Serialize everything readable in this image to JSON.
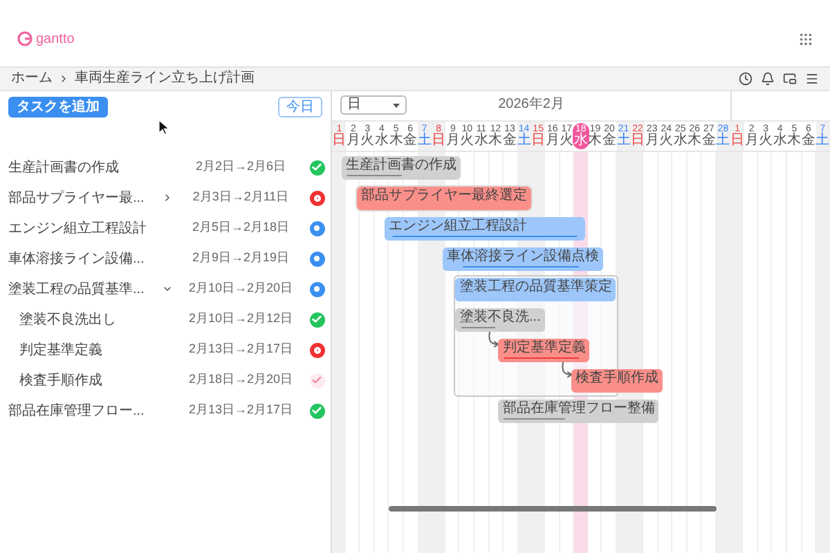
{
  "app": {
    "logo": "gantto"
  },
  "breadcrumb": [
    "ホーム",
    "車両生産ライン立ち上げ計画"
  ],
  "toolbar": {
    "add_button": "タスクを追加",
    "today_button": "今日",
    "scale_select": "日"
  },
  "month": "2026年2月",
  "days": [
    {
      "day": "1",
      "weekday": "日",
      "kind": "sunday",
      "selected": false
    },
    {
      "day": "2",
      "weekday": "月",
      "kind": "weekday",
      "selected": false
    },
    {
      "day": "3",
      "weekday": "火",
      "kind": "weekday",
      "selected": false
    },
    {
      "day": "4",
      "weekday": "水",
      "kind": "weekday",
      "selected": false
    },
    {
      "day": "5",
      "weekday": "木",
      "kind": "weekday",
      "selected": false
    },
    {
      "day": "6",
      "weekday": "金",
      "kind": "weekday",
      "selected": false
    },
    {
      "day": "7",
      "weekday": "土",
      "kind": "saturday",
      "selected": false
    },
    {
      "day": "8",
      "weekday": "日",
      "kind": "sunday",
      "selected": false
    },
    {
      "day": "9",
      "weekday": "月",
      "kind": "weekday",
      "selected": false
    },
    {
      "day": "10",
      "weekday": "火",
      "kind": "weekday",
      "selected": false
    },
    {
      "day": "11",
      "weekday": "水",
      "kind": "weekday",
      "selected": false
    },
    {
      "day": "12",
      "weekday": "木",
      "kind": "weekday",
      "selected": false
    },
    {
      "day": "13",
      "weekday": "金",
      "kind": "weekday",
      "selected": false
    },
    {
      "day": "14",
      "weekday": "土",
      "kind": "saturday",
      "selected": false
    },
    {
      "day": "15",
      "weekday": "日",
      "kind": "sunday",
      "selected": false
    },
    {
      "day": "16",
      "weekday": "月",
      "kind": "weekday",
      "selected": false
    },
    {
      "day": "17",
      "weekday": "火",
      "kind": "weekday",
      "selected": false
    },
    {
      "day": "18",
      "weekday": "水",
      "kind": "weekday",
      "selected": true
    },
    {
      "day": "19",
      "weekday": "木",
      "kind": "weekday",
      "selected": false
    },
    {
      "day": "20",
      "weekday": "金",
      "kind": "weekday",
      "selected": false
    },
    {
      "day": "21",
      "weekday": "土",
      "kind": "saturday",
      "selected": false
    },
    {
      "day": "22",
      "weekday": "日",
      "kind": "sunday",
      "selected": false
    },
    {
      "day": "23",
      "weekday": "月",
      "kind": "weekday",
      "selected": false
    },
    {
      "day": "24",
      "weekday": "火",
      "kind": "weekday",
      "selected": false
    },
    {
      "day": "25",
      "weekday": "水",
      "kind": "weekday",
      "selected": false
    },
    {
      "day": "26",
      "weekday": "木",
      "kind": "weekday",
      "selected": false
    },
    {
      "day": "27",
      "weekday": "金",
      "kind": "weekday",
      "selected": false
    },
    {
      "day": "28",
      "weekday": "土",
      "kind": "saturday",
      "selected": false
    },
    {
      "day": "1",
      "weekday": "日",
      "kind": "sunday",
      "selected": false
    },
    {
      "day": "2",
      "weekday": "月",
      "kind": "weekday",
      "selected": false
    },
    {
      "day": "3",
      "weekday": "火",
      "kind": "weekday",
      "selected": false
    },
    {
      "day": "4",
      "weekday": "水",
      "kind": "weekday",
      "selected": false
    },
    {
      "day": "5",
      "weekday": "木",
      "kind": "weekday",
      "selected": false
    },
    {
      "day": "6",
      "weekday": "金",
      "kind": "weekday",
      "selected": false
    },
    {
      "day": "7",
      "weekday": "土",
      "kind": "saturday",
      "selected": false
    }
  ],
  "tasks": [
    {
      "name": "生産計画書の作成",
      "dates": "2月2日→2月6日",
      "kind": "done",
      "bar_label": "生産計画書の作成"
    },
    {
      "name": "部品サプライヤー最...",
      "dates": "2月3日→2月11日",
      "kind": "blocked",
      "expanded": false,
      "bar_label": "部品サプライヤー最終選定"
    },
    {
      "name": "エンジン組立工程設計",
      "dates": "2月5日→2月18日",
      "kind": "active",
      "bar_label": "エンジン組立工程設計"
    },
    {
      "name": "車体溶接ライン設備...",
      "dates": "2月9日→2月19日",
      "kind": "active",
      "bar_label": "車体溶接ライン設備点検"
    },
    {
      "name": "塗装工程の品質基準...",
      "dates": "2月10日→2月20日",
      "kind": "active",
      "expanded": true,
      "bar_label": "塗装工程の品質基準策定",
      "children": [
        {
          "name": "塗装不良洗出し",
          "dates": "2月10日→2月12日",
          "kind": "done",
          "bar_label": "塗装不良洗..."
        },
        {
          "name": "判定基準定義",
          "dates": "2月13日→2月17日",
          "kind": "blocked",
          "bar_label": "判定基準定義"
        },
        {
          "name": "検査手順作成",
          "dates": "2月18日→2月20日",
          "kind": "pending",
          "bar_label": "検査手順作成"
        }
      ]
    },
    {
      "name": "部品在庫管理フロー...",
      "dates": "2月13日→2月17日",
      "kind": "done",
      "bar_label": "部品在庫管理フロー整備"
    }
  ]
}
